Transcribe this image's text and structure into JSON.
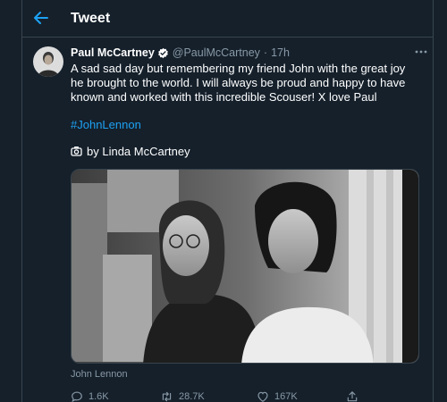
{
  "header": {
    "title": "Tweet",
    "back_icon": "back-arrow-icon",
    "accent": "#1da1f2"
  },
  "tweet": {
    "author_name": "Paul McCartney",
    "handle": "@PaulMcCartney",
    "separator": "·",
    "time": "17h",
    "verified_icon": "verified-badge-icon",
    "text": "A sad sad day but remembering my friend John with the great joy he brought to the world. I will always be proud and happy to have known and worked with this incredible Scouser! X love Paul",
    "hashtag": "#JohnLennon",
    "photo_credit": "by Linda McCartney",
    "photo_credit_icon": "camera-icon",
    "image_caption": "John Lennon"
  },
  "actions": {
    "reply_count": "1.6K",
    "retweet_count": "28.7K",
    "like_count": "167K",
    "share_icon": "share-icon"
  },
  "colors": {
    "background": "#15202b",
    "border": "#38444d",
    "secondary_text": "#8899a6",
    "link": "#1da1f2"
  }
}
